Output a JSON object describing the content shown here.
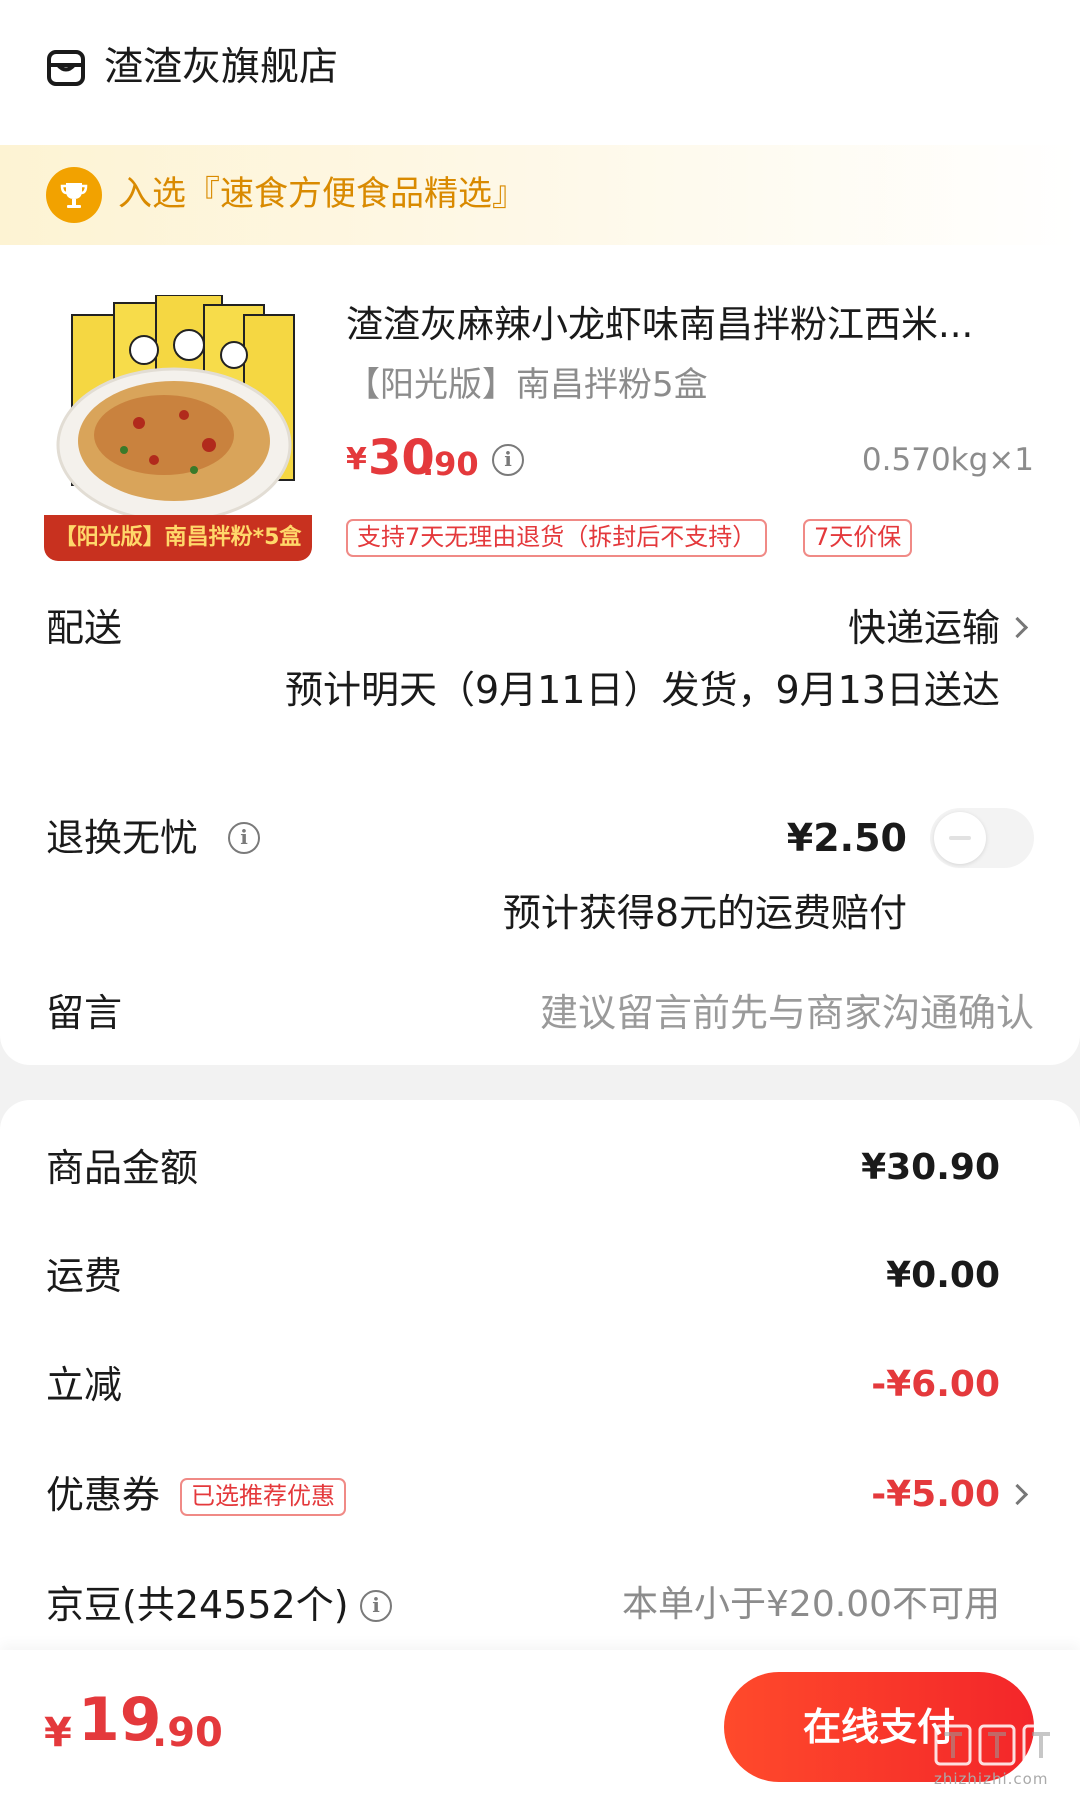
{
  "store": {
    "name": "渣渣灰旗舰店",
    "icon": "store-icon"
  },
  "banner": {
    "text": "入选『速食方便食品精选』",
    "icon": "trophy-icon"
  },
  "product": {
    "image_caption": "【阳光版】南昌拌粉*5盒",
    "title": "渣渣灰麻辣小龙虾味南昌拌粉江西米...",
    "spec": "【阳光版】南昌拌粉5盒",
    "price_symbol": "¥",
    "price_int": "30",
    "price_dec": ".90",
    "weight": "0.570kg×1",
    "tags": [
      "支持7天无理由退货（拆封后不支持）",
      "7天价保"
    ]
  },
  "delivery": {
    "label": "配送",
    "method": "快递运输",
    "estimate": "预计明天（9月11日）发货，9月13日送达"
  },
  "return_insurance": {
    "label": "退换无忧",
    "price": "¥2.50",
    "note": "预计获得8元的运费赔付",
    "enabled": false
  },
  "message": {
    "label": "留言",
    "placeholder": "建议留言前先与商家沟通确认"
  },
  "summary": {
    "goods_label": "商品金额",
    "goods_value": "¥30.90",
    "shipping_label": "运费",
    "shipping_value": "¥0.00",
    "discount_label": "立减",
    "discount_value": "-¥6.00",
    "coupon_label": "优惠券",
    "coupon_tag": "已选推荐优惠",
    "coupon_value": "-¥5.00",
    "beans_label": "京豆(共24552个)",
    "beans_value": "本单小于¥20.00不可用"
  },
  "footer": {
    "total_symbol": "¥",
    "total_int": "19",
    "total_dec": ".90",
    "pay_button": "在线支付",
    "watermark_text": "zhizhizhi.com"
  },
  "colors": {
    "accent_red": "#e4393c",
    "banner_orange": "#d98a00",
    "trophy_orange": "#f2a200"
  }
}
